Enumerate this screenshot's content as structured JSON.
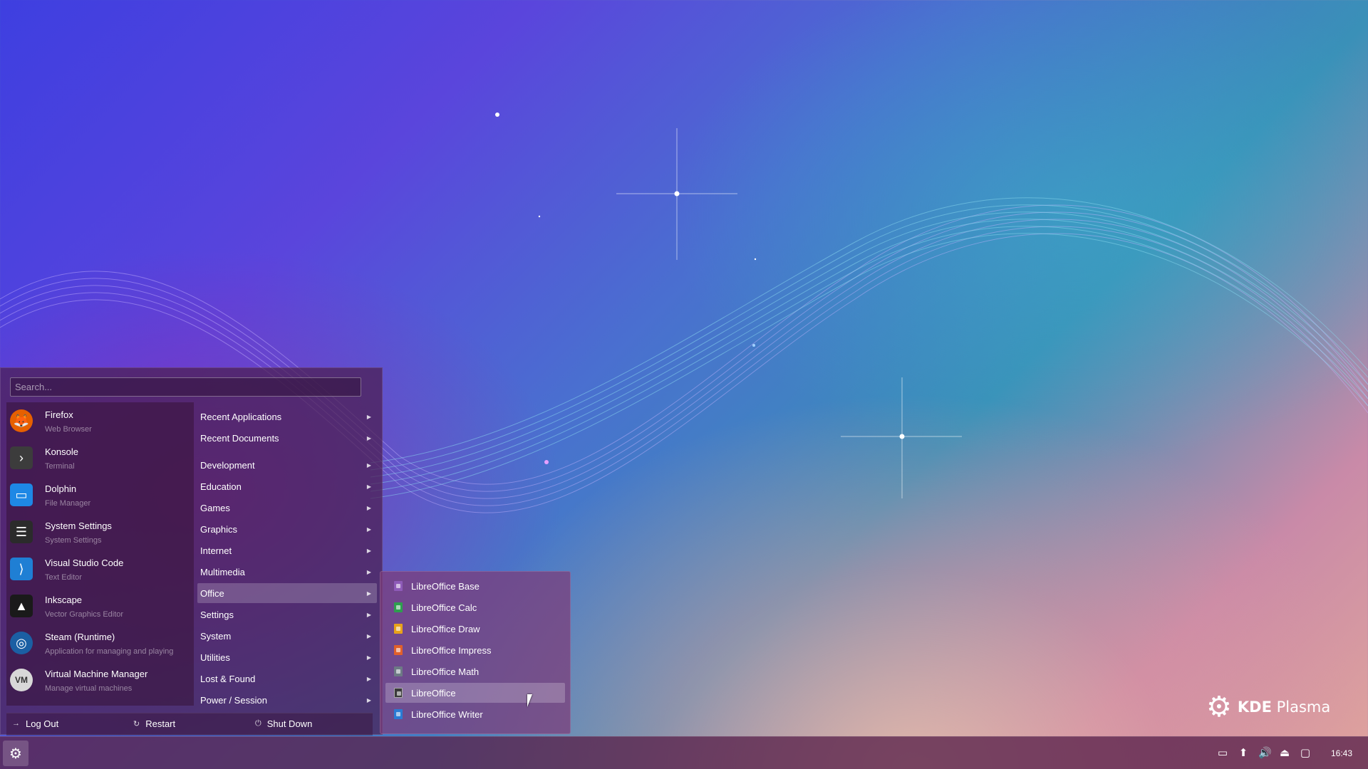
{
  "wallpaper": {
    "logo_brand": "KDE",
    "logo_product": "Plasma"
  },
  "launcher": {
    "search_placeholder": "Search...",
    "favorites": [
      {
        "name": "Firefox",
        "description": "Web Browser",
        "icon": "firefox-icon",
        "color": "#e66000"
      },
      {
        "name": "Konsole",
        "description": "Terminal",
        "icon": "terminal-icon",
        "color": "#3c3c3c"
      },
      {
        "name": "Dolphin",
        "description": "File Manager",
        "icon": "folder-icon",
        "color": "#1e88e5"
      },
      {
        "name": "System Settings",
        "description": "System Settings",
        "icon": "settings-icon",
        "color": "#2b2b2b"
      },
      {
        "name": "Visual Studio Code",
        "description": "Text Editor",
        "icon": "vscode-icon",
        "color": "#1f7fd4"
      },
      {
        "name": "Inkscape",
        "description": "Vector Graphics Editor",
        "icon": "inkscape-icon",
        "color": "#1a1a1a"
      },
      {
        "name": "Steam (Runtime)",
        "description": "Application for managing and playing",
        "icon": "steam-icon",
        "color": "#1b5fa3"
      },
      {
        "name": "Virtual Machine Manager",
        "description": "Manage virtual machines",
        "icon": "vm-icon",
        "color": "#d8d8d8"
      }
    ],
    "categories": [
      {
        "label": "Recent Applications"
      },
      {
        "label": "Recent Documents"
      },
      {
        "label": "Development"
      },
      {
        "label": "Education"
      },
      {
        "label": "Games"
      },
      {
        "label": "Graphics"
      },
      {
        "label": "Internet"
      },
      {
        "label": "Multimedia"
      },
      {
        "label": "Office"
      },
      {
        "label": "Settings"
      },
      {
        "label": "System"
      },
      {
        "label": "Utilities"
      },
      {
        "label": "Lost & Found"
      },
      {
        "label": "Power / Session"
      }
    ],
    "selected_category": "Office",
    "session": {
      "logout_label": "Log Out",
      "restart_label": "Restart",
      "shutdown_label": "Shut Down"
    }
  },
  "office_submenu": {
    "items": [
      {
        "label": "LibreOffice Base",
        "color": "#8e5bb8"
      },
      {
        "label": "LibreOffice Calc",
        "color": "#2e9e4f"
      },
      {
        "label": "LibreOffice Draw",
        "color": "#e8a21a"
      },
      {
        "label": "LibreOffice Impress",
        "color": "#e0602b"
      },
      {
        "label": "LibreOffice Math",
        "color": "#6d7a85"
      },
      {
        "label": "LibreOffice",
        "color": "#3a3a3a"
      },
      {
        "label": "LibreOffice Writer",
        "color": "#2a7bd4"
      }
    ],
    "hovered": "LibreOffice"
  },
  "taskbar": {
    "tray_icons": [
      "notifications-icon",
      "updates-icon",
      "volume-icon",
      "drive-icon",
      "display-icon"
    ],
    "clock": "16:43"
  }
}
